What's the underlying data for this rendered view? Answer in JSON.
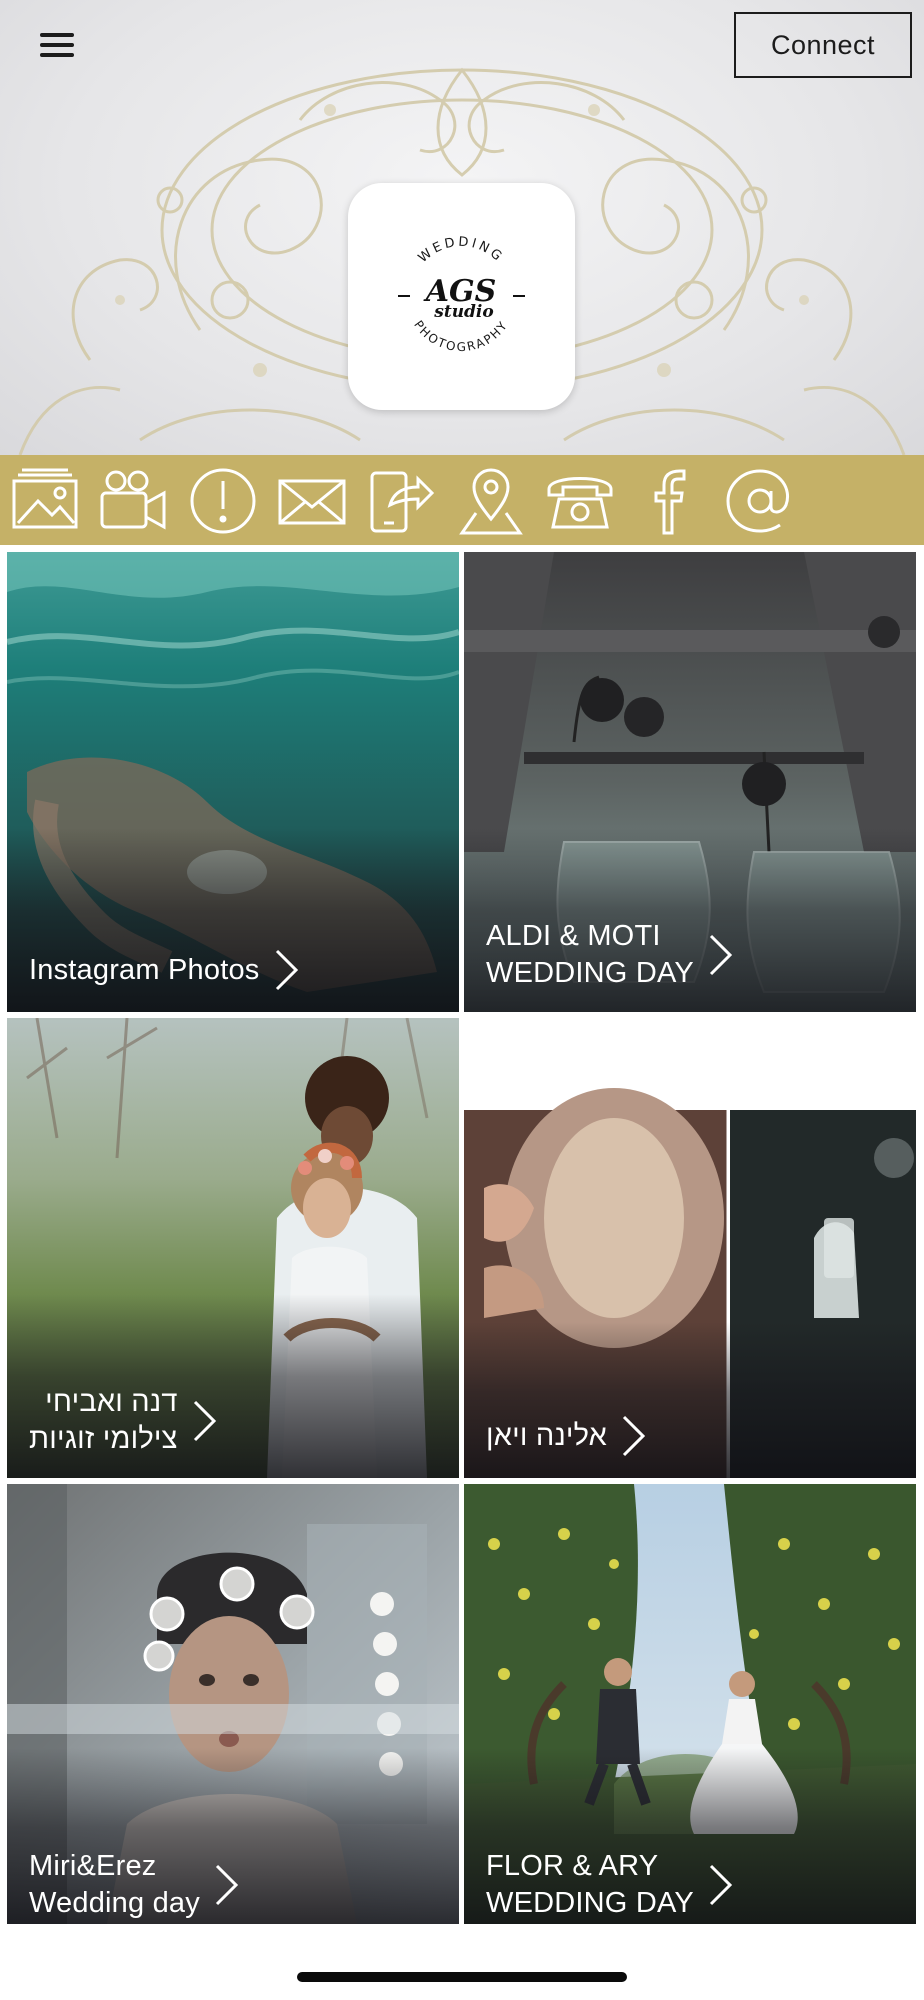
{
  "header": {
    "menu_icon": "hamburger-menu-icon",
    "connect_label": "Connect"
  },
  "logo": {
    "top_text": "WEDDING",
    "main_text": "AGS",
    "script_text": "studio",
    "bottom_text": "PHOTOGRAPHY"
  },
  "icon_bar": {
    "background": "#c5b167",
    "icons": [
      "gallery-icon",
      "video-camera-icon",
      "info-icon",
      "mail-icon",
      "share-icon",
      "location-pin-icon",
      "phone-icon",
      "facebook-icon",
      "at-sign-icon"
    ]
  },
  "tiles": [
    {
      "caption": "Instagram Photos"
    },
    {
      "caption": "ALDI & MOTI\nWEDDING DAY"
    },
    {
      "caption": "דנה ואביחי\nצילומי זוגיות"
    },
    {
      "caption": "אלינה ויאן"
    },
    {
      "caption": "Miri&Erez\nWedding day"
    },
    {
      "caption": "FLOR & ARY\nWEDDING DAY"
    }
  ]
}
